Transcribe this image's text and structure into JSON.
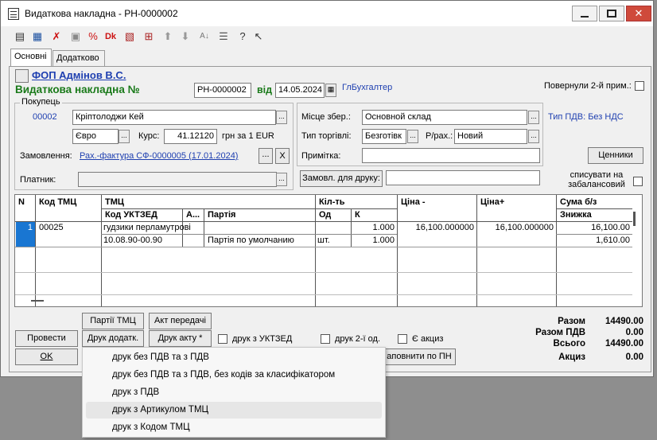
{
  "window": {
    "title": "Видаткова накладна - РН-0000002"
  },
  "tabs": [
    {
      "label": "Основні"
    },
    {
      "label": "Додатково"
    }
  ],
  "header": {
    "org": "ФОП Адмінов В.С.",
    "doc_title": "Видаткова накладна №",
    "doc_number": "РН-0000002",
    "date_label": "від",
    "date": "14.05.2024",
    "ledger": "ГлБухгалтер",
    "returned_label": "Повернули 2-й прим.:"
  },
  "buyer": {
    "group_title": "Покупець",
    "code": "00002",
    "name": "Кріптолоджи Кей",
    "currency": "Євро",
    "rate_label": "Курс:",
    "rate": "41.12120",
    "rate_unit": "грн за 1 EUR",
    "order_label": "Замовлення:",
    "order": "Рах.-фактура СФ-0000005 (17.01.2024)",
    "payer_label": "Платник:",
    "payer": "",
    "clear_btn": "X"
  },
  "storage": {
    "place_label": "Місце збер.:",
    "place": "Основной склад",
    "trade_label": "Тип торгівлі:",
    "trade": "Безготівк",
    "account_label": "Р/рах.:",
    "account": "Новий",
    "note_label": "Примітка:",
    "note": "",
    "vat_type": "Тип ПДВ: Без НДС",
    "price_btn": "Ценники",
    "order_print_btn": "Замовл. для друку:",
    "offbalance_label": "списувати на забалансовий"
  },
  "grid": {
    "headers": {
      "n": "N",
      "code": "Код ТМЦ",
      "tmc": "ТМЦ",
      "uktzed": "Код УКТЗЕД",
      "a": "А...",
      "batch": "Партія",
      "qty": "Кіл-ть",
      "unit": "Од",
      "k": "К",
      "price_minus": "Ціна -",
      "price_plus": "Ціна+",
      "sum": "Сума б/з",
      "discount": "Знижка"
    },
    "rows": [
      {
        "n": "1",
        "code": "00025",
        "name": "гудзики перламутрові",
        "uktzed": "10.08.90-00.90",
        "batch": "Партія по умолчанию",
        "unit": "шт.",
        "qty": "1.000",
        "k": "1.000",
        "price_minus": "16,100.000000",
        "price_plus": "16,100.000000",
        "sum": "16,100.00",
        "discount": "1,610.00"
      }
    ]
  },
  "buttons": {
    "batches": "Партії ТМЦ",
    "transfer_act": "Акт передачі",
    "post": "Провести",
    "print_add": "Друк додатк.",
    "print_act": "Друк акту *",
    "ok": "OK",
    "fill_pn": "аповнити по ПН"
  },
  "checks": {
    "print_uktzed": "друк з УКТЗЕД",
    "print_2nd": "друк 2-ї од.",
    "excise": "Є акциз"
  },
  "totals": [
    {
      "label": "Разом",
      "value": "14490.00"
    },
    {
      "label": "Разом ПДВ",
      "value": "0.00"
    },
    {
      "label": "Всього",
      "value": "14490.00"
    },
    {
      "label": "Акциз",
      "value": "0.00"
    }
  ],
  "menu": [
    {
      "label": "друк без ПДВ та з ПДВ"
    },
    {
      "label": "друк без ПДВ та з ПДВ, без кодів за класифікатором"
    },
    {
      "label": "друк з ПДВ"
    },
    {
      "label": "друк з Артикулом ТМЦ"
    },
    {
      "label": "друк з Кодом ТМЦ"
    }
  ],
  "icons": [
    "document-icon",
    "add-row-icon",
    "edit-row-icon",
    "delete-row-icon",
    "copy-icon",
    "discount-icon",
    "dk-icon",
    "properties-icon",
    "split-icon",
    "arrow-up-icon",
    "arrow-down-icon",
    "sort-az-icon",
    "sort-list-icon",
    "help-icon",
    "pointer-help-icon"
  ]
}
